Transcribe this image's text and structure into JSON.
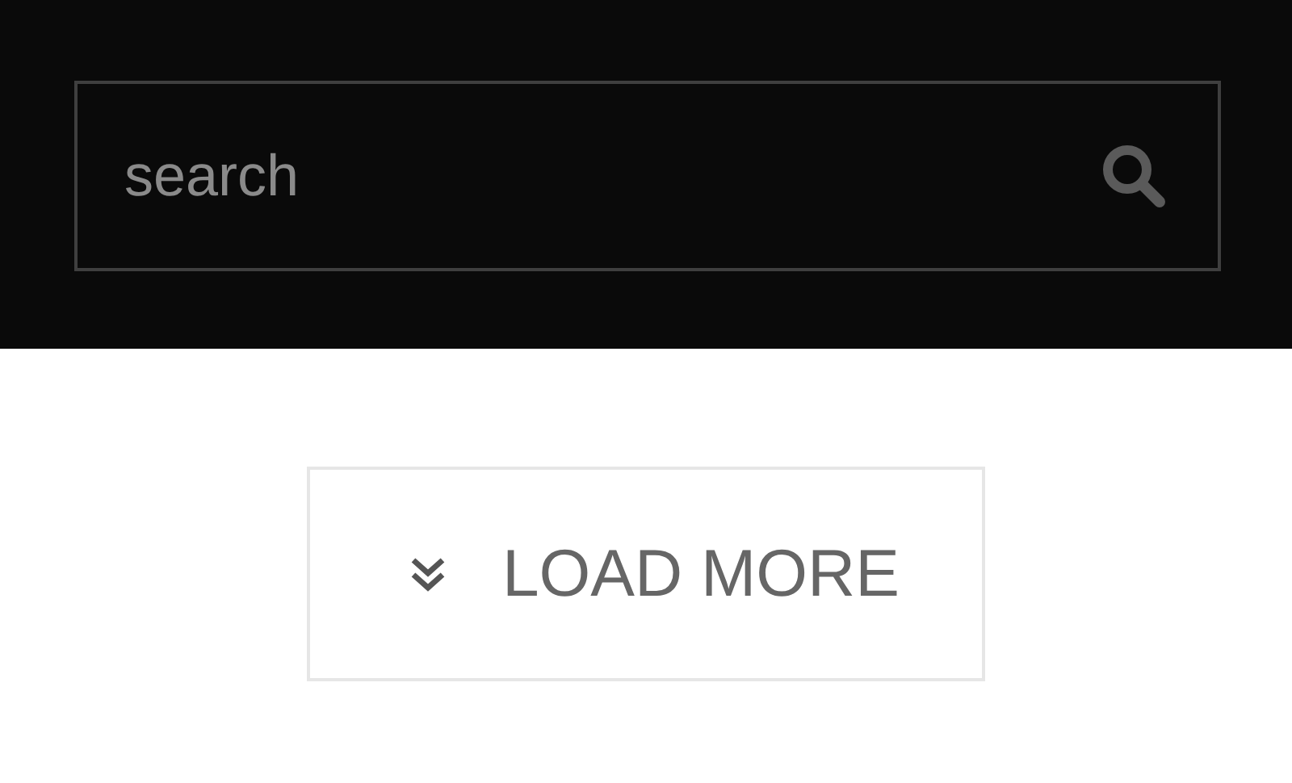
{
  "search": {
    "placeholder": "search"
  },
  "load_more": {
    "label": "LOAD MORE"
  }
}
